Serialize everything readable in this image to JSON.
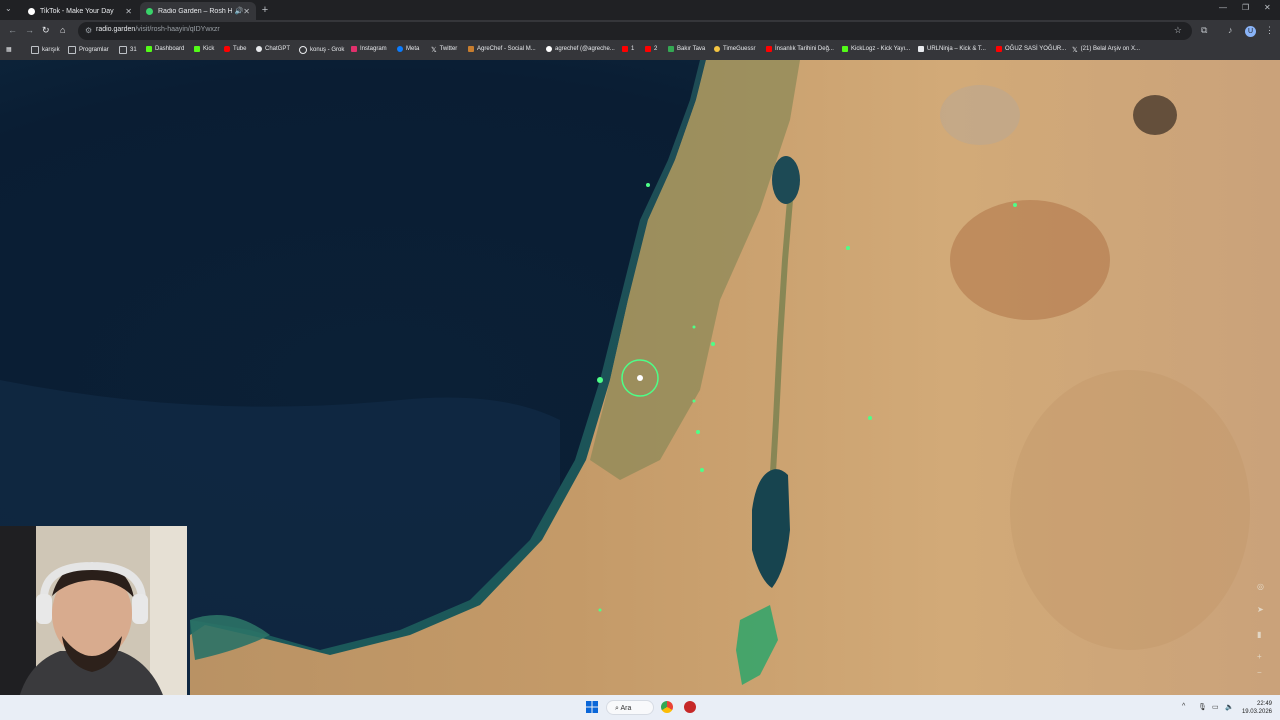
{
  "browser": {
    "tabs": [
      {
        "title": "TikTok - Make Your Day",
        "active": false
      },
      {
        "title": "Radio Garden – Rosh Haay",
        "active": true
      }
    ],
    "url_domain": "radio.garden",
    "url_path": "/visit/rosh-haayin/qIDYwxzr",
    "profile_initial": "U"
  },
  "bookmarks": [
    "karışık",
    "Programlar",
    "31",
    "Dashboard",
    "Kick",
    "Tube",
    "ChatGPT",
    "konuş - Grok",
    "Instagram",
    "Meta",
    "Twitter",
    "AgreChef - Social M...",
    "agrechef (@agreche...",
    "1",
    "2",
    "Bakır Tava",
    "TimeGuessr",
    "İnsanlık Tarihini Değ...",
    "KickLogz - Kick Yayı...",
    "URLNinja – Kick & T...",
    "OĞUZ SASİ YOĞUR...",
    "(21) Belal Arşiv on X..."
  ],
  "taskbar": {
    "search_label": "Ara",
    "time": "22:49",
    "date": "19.03.2026"
  },
  "colors": {
    "accent": "#4dff88",
    "sea_dark": "#0c1f33",
    "land": "#c9a26e"
  }
}
